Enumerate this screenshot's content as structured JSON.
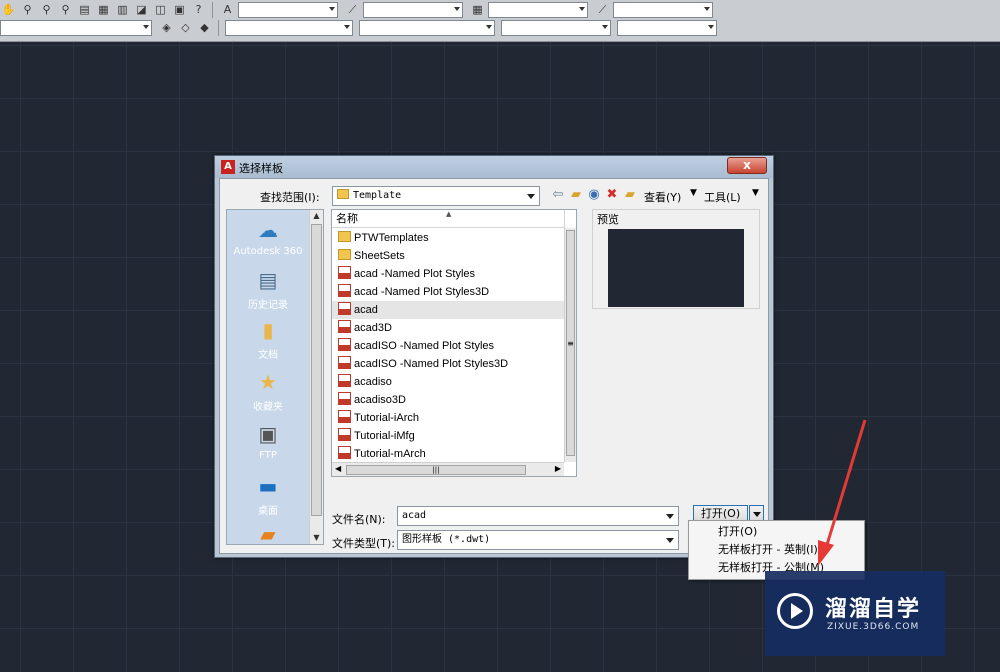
{
  "toolbar": {
    "row1_icons": [
      "pan-icon",
      "zoom-realtime-icon",
      "zoom-window-icon",
      "zoom-previous-icon",
      "properties-icon",
      "design-center-icon",
      "tool-palettes-icon",
      "sheet-set-icon",
      "markup-icon",
      "quickcalc-icon",
      "help-icon"
    ],
    "row2_icons": [
      "layer-properties-icon",
      "layer-state-icon",
      "layer-previous-icon"
    ]
  },
  "dialog": {
    "title": "选择样板",
    "close_label": "x",
    "lookin_label": "查找范围(I):",
    "lookin_value": "Template",
    "views_label": "查看(Y)",
    "tools_label": "工具(L)",
    "places": [
      {
        "label": "Autodesk 360",
        "icon": "cloud-icon"
      },
      {
        "label": "历史记录",
        "icon": "history-icon"
      },
      {
        "label": "文档",
        "icon": "documents-icon"
      },
      {
        "label": "收藏夹",
        "icon": "favorites-icon"
      },
      {
        "label": "FTP",
        "icon": "ftp-icon"
      },
      {
        "label": "桌面",
        "icon": "desktop-icon"
      }
    ],
    "column_name": "名称",
    "files": [
      {
        "name": "PTWTemplates",
        "type": "folder"
      },
      {
        "name": "SheetSets",
        "type": "folder"
      },
      {
        "name": "acad -Named Plot Styles",
        "type": "dwt"
      },
      {
        "name": "acad -Named Plot Styles3D",
        "type": "dwt"
      },
      {
        "name": "acad",
        "type": "dwt",
        "selected": true
      },
      {
        "name": "acad3D",
        "type": "dwt"
      },
      {
        "name": "acadISO -Named Plot Styles",
        "type": "dwt"
      },
      {
        "name": "acadISO -Named Plot Styles3D",
        "type": "dwt"
      },
      {
        "name": "acadiso",
        "type": "dwt"
      },
      {
        "name": "acadiso3D",
        "type": "dwt"
      },
      {
        "name": "Tutorial-iArch",
        "type": "dwt"
      },
      {
        "name": "Tutorial-iMfg",
        "type": "dwt"
      },
      {
        "name": "Tutorial-mArch",
        "type": "dwt"
      }
    ],
    "preview_label": "预览",
    "filename_label": "文件名(N):",
    "filename_value": "acad",
    "filetype_label": "文件类型(T):",
    "filetype_value": "图形样板 (*.dwt)",
    "open_label": "打开(O)"
  },
  "open_menu": {
    "items": [
      "打开(O)",
      "无样板打开 - 英制(I)",
      "无样板打开 - 公制(M)"
    ]
  },
  "watermark": {
    "brand": "溜溜自学",
    "url": "ZIXUE.3D66.COM"
  },
  "colors": {
    "canvas": "#212833",
    "annotation_arrow": "#e53935",
    "dialog_frame": "#b9c6d4"
  }
}
